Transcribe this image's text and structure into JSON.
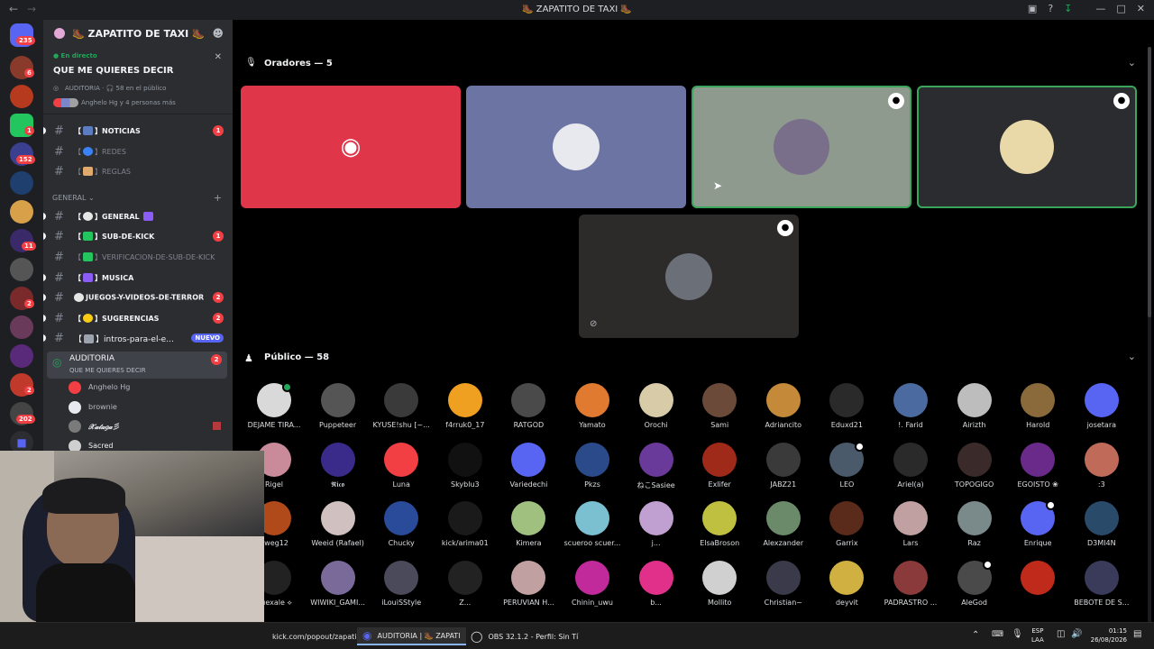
{
  "window": {
    "title": "🥾 ZAPATITO DE TAXI 🥾"
  },
  "rail": {
    "badges": [
      "235",
      "6",
      "1",
      "152",
      "11",
      "2",
      "2",
      "202"
    ]
  },
  "server": {
    "name": "🥾 ZAPATITO DE TAXI 🥾"
  },
  "live_panel": {
    "status": "En directo",
    "title": "QUE ME QUIERES DECIR",
    "meta": "AUDITORIA · 🎧 58 en el público",
    "people": "Anghelo Hg y 4 personas más"
  },
  "channels": {
    "noticias": "NOTICIAS",
    "noticias_badge": "1",
    "redes": "REDES",
    "reglas": "REGLAS",
    "category": "GENERAL",
    "general": "GENERAL",
    "subdekick": "SUB-DE-KICK",
    "subdekick_badge": "1",
    "verificacion": "VERIFICACION-DE-SUB-DE-KICK",
    "musica": "MUSICA",
    "juegos": "JUEGOS-Y-VIDEOS-DE-TERROR",
    "juegos_badge": "2",
    "sugerencias": "SUGERENCIAS",
    "sugerencias_badge": "2",
    "intros": "intros-para-el-e...",
    "intros_badge": "NUEVO",
    "auditoria": "AUDITORIA",
    "auditoria_sub": "QUE ME QUIERES DECIR",
    "auditoria_badge": "2"
  },
  "voice_users": [
    "Anghelo Hg",
    "brownie",
    "𝒳𝒶𝓉𝒶𝑔𝒶彡",
    "Sacred"
  ],
  "stage": {
    "speakers_header": "Oradores — 5",
    "audience_header": "Público — 58"
  },
  "audience": [
    "DEJAME TIRA...",
    "Puppeteer",
    "KYUSE!shu [~...",
    "f4rruk0_17",
    "RATGOD",
    "Yamato",
    "Orochi",
    "Sami",
    "Adriancito",
    "Eduxd21",
    "!. Farid",
    "Airizth",
    "Harold",
    "josetara",
    "Rigel",
    "𝕽𝖎𝖈𝖔",
    "Luna",
    "Skyblu3",
    "Variedechi",
    "Pkzs",
    "ねこSasiee",
    "Exlifer",
    "JABZ21",
    "LEO",
    "Ariel(a)",
    "TOPOGIGO",
    "EGOISTO ❀",
    ":3",
    "gweg12",
    "Weeid (Rafael)",
    "Chucky",
    "kick/arima01",
    "Kimera",
    "scueroo scuer...",
    "j...",
    "ElsaBroson",
    "Alexzander",
    "Garrix",
    "Lars",
    "Raz",
    "Enrique",
    "D3MI4N",
    "puexale ⟡",
    "WIWIKI_GAMI...",
    "iLouiSStyle",
    "Z...",
    "PERUVIAN H...",
    "Chinin_uwu",
    "b...",
    "Mollito",
    "Christian~",
    "deyvit",
    "PADRASTRO ...",
    "AleGod",
    "",
    "BEBOTE DE S..."
  ],
  "taskbar": {
    "browser": "kick.com/popout/zapati",
    "discord": "AUDITORIA | 🥾 ZAPATI",
    "obs": "OBS 32.1.2 - Perfil: Sin Tí",
    "lang": "ESP",
    "lang2": "LAA",
    "time": "01:15",
    "date": "26/08/2026"
  },
  "colors": {
    "accent": "#5865f2",
    "danger": "#f23f43",
    "live": "#23a55a",
    "speaking": "#3ba55c"
  }
}
